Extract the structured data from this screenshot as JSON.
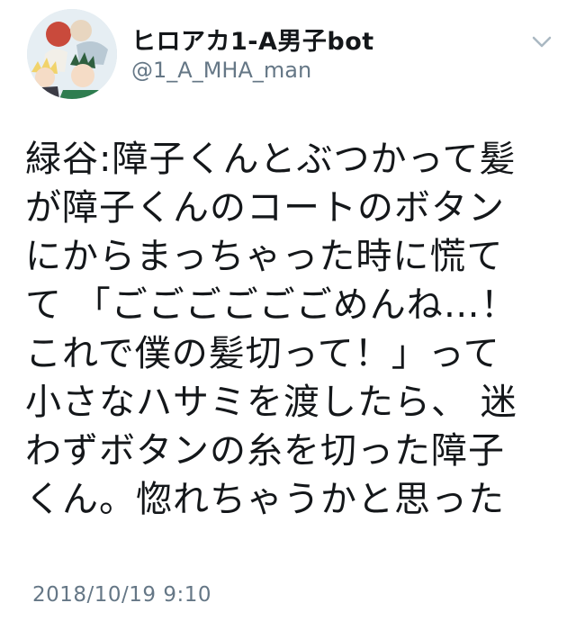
{
  "profile": {
    "display_name": "ヒロアカ1-A男子bot",
    "handle": "@1_A_MHA_man",
    "avatar_icon": "anime-group-avatar",
    "menu_icon": "chevron-down-icon"
  },
  "tweet": {
    "lines": [
      "緑谷:障子くんとぶつかって髪",
      "が障子くんのコートのボタン",
      "にからまっちゃった時に慌て",
      "て 「ごごごごごごめんね…！",
      "これで僕の髪切って！」って",
      "小さなハサミを渡したら、 迷",
      "わずボタンの糸を切った障子",
      "くん。惚れちゃうかと思った"
    ],
    "timestamp": "2018/10/19 9:10"
  },
  "colors": {
    "text": "#14171a",
    "secondary": "#657786",
    "chevron": "#aab8c2"
  }
}
